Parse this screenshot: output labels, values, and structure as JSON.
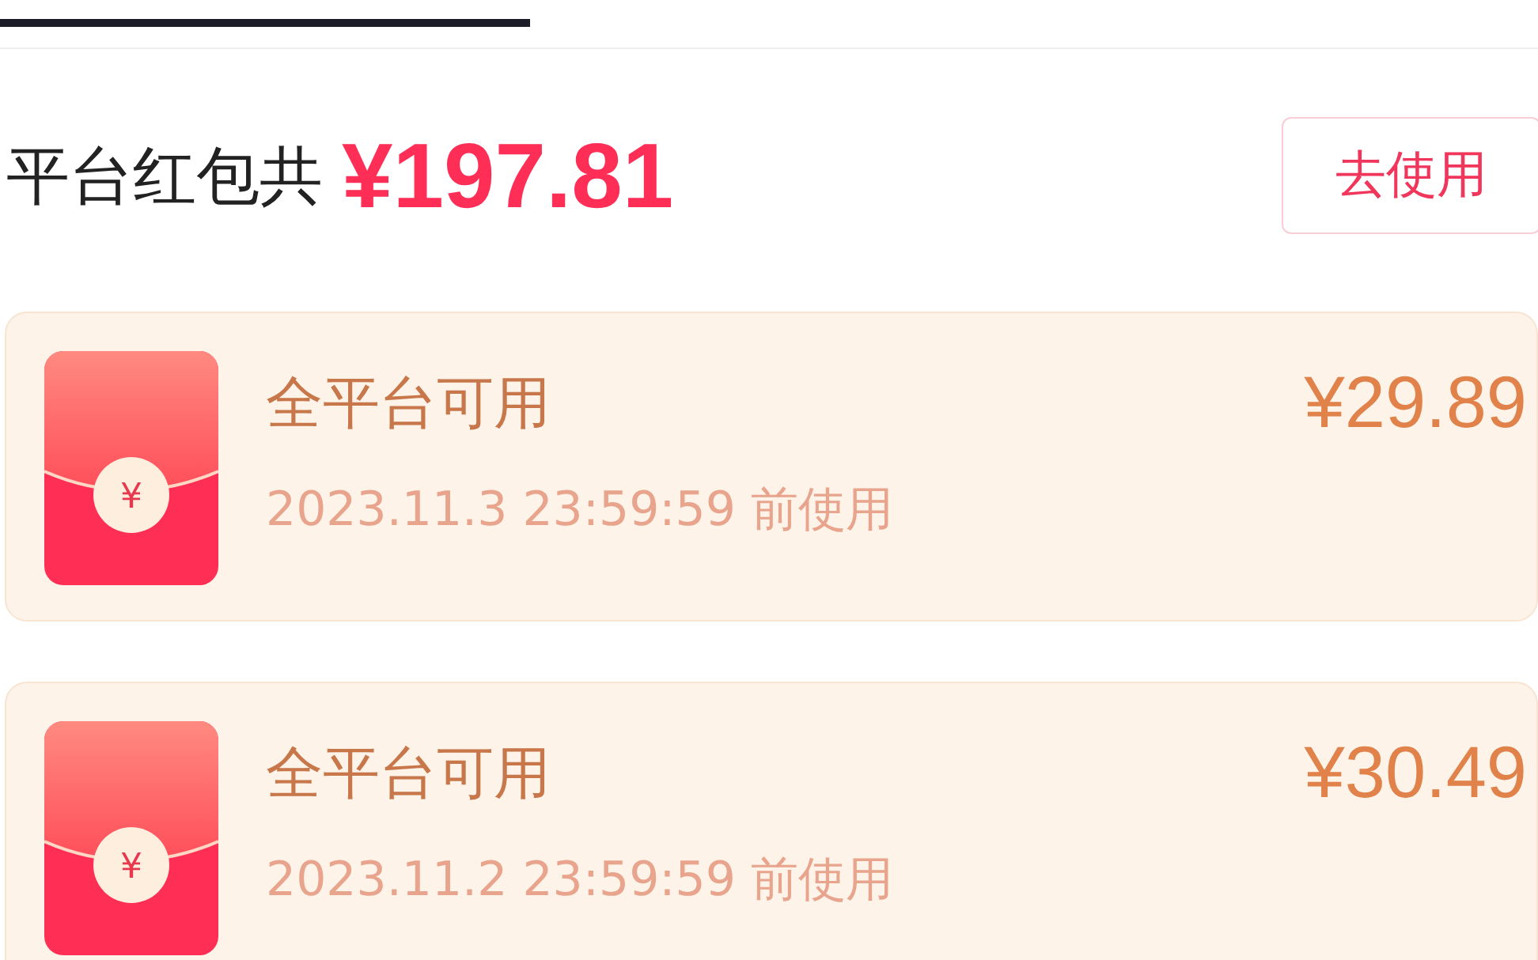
{
  "summary": {
    "label": "平台红包共",
    "total": "¥197.81",
    "button": "去使用"
  },
  "packets": [
    {
      "title": "全平台可用",
      "expiry": "2023.11.3 23:59:59 前使用",
      "amount": "¥29.89",
      "icon_symbol": "¥"
    },
    {
      "title": "全平台可用",
      "expiry": "2023.11.2 23:59:59 前使用",
      "amount": "¥30.49",
      "icon_symbol": "¥"
    }
  ]
}
